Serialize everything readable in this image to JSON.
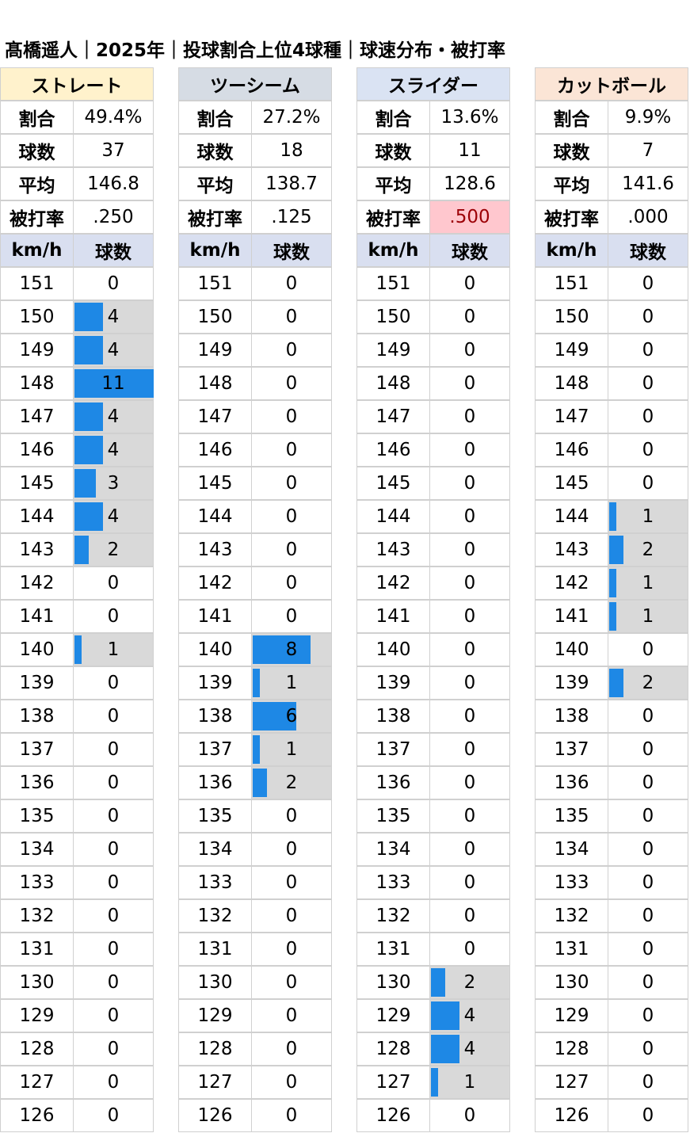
{
  "title": "髙橋遥人｜2025年｜投球割合上位4球種｜球速分布・被打率",
  "speed_header": "km/h",
  "count_header": "球数",
  "stat_labels": [
    "割合",
    "球数",
    "平均",
    "被打率"
  ],
  "colors": {
    "bar": "#1e88e5",
    "bar_bg": "#d9d9d9",
    "sub_header": "#d9dff0",
    "highlight": "#ffc7ce",
    "highlight_text": "#9c0006"
  },
  "chart_data": {
    "type": "table",
    "speeds": [
      151,
      150,
      149,
      148,
      147,
      146,
      145,
      144,
      143,
      142,
      141,
      140,
      139,
      138,
      137,
      136,
      135,
      134,
      133,
      132,
      131,
      130,
      129,
      128,
      127,
      126
    ],
    "max_count": 11,
    "pitches": [
      {
        "name": "ストレート",
        "header_color": "#fff2cc",
        "ratio": "49.4%",
        "count": "37",
        "avg": "146.8",
        "avg_against": ".250",
        "highlight": false,
        "counts": [
          0,
          4,
          4,
          11,
          4,
          4,
          3,
          4,
          2,
          0,
          0,
          1,
          0,
          0,
          0,
          0,
          0,
          0,
          0,
          0,
          0,
          0,
          0,
          0,
          0,
          0
        ]
      },
      {
        "name": "ツーシーム",
        "header_color": "#d6dce4",
        "ratio": "27.2%",
        "count": "18",
        "avg": "138.7",
        "avg_against": ".125",
        "highlight": false,
        "counts": [
          0,
          0,
          0,
          0,
          0,
          0,
          0,
          0,
          0,
          0,
          0,
          8,
          1,
          6,
          1,
          2,
          0,
          0,
          0,
          0,
          0,
          0,
          0,
          0,
          0,
          0
        ]
      },
      {
        "name": "スライダー",
        "header_color": "#dae3f3",
        "ratio": "13.6%",
        "count": "11",
        "avg": "128.6",
        "avg_against": ".500",
        "highlight": true,
        "counts": [
          0,
          0,
          0,
          0,
          0,
          0,
          0,
          0,
          0,
          0,
          0,
          0,
          0,
          0,
          0,
          0,
          0,
          0,
          0,
          0,
          0,
          2,
          4,
          4,
          1,
          0
        ]
      },
      {
        "name": "カットボール",
        "header_color": "#fbe5d6",
        "ratio": "9.9%",
        "count": "7",
        "avg": "141.6",
        "avg_against": ".000",
        "highlight": false,
        "counts": [
          0,
          0,
          0,
          0,
          0,
          0,
          0,
          1,
          2,
          1,
          1,
          0,
          2,
          0,
          0,
          0,
          0,
          0,
          0,
          0,
          0,
          0,
          0,
          0,
          0,
          0
        ]
      }
    ]
  }
}
